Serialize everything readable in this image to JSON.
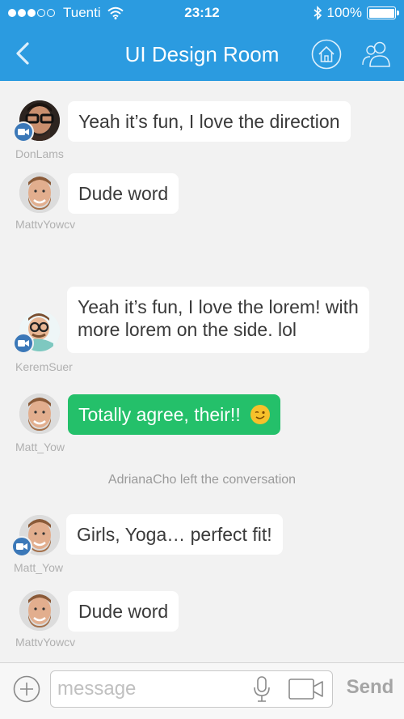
{
  "status_bar": {
    "carrier": "Tuenti",
    "time": "23:12",
    "battery": "100%",
    "signal_bars": 3,
    "signal_total": 5,
    "icons": [
      "wifi-icon",
      "bluetooth-icon",
      "battery-icon"
    ]
  },
  "header": {
    "title": "UI Design Room",
    "icons": [
      "back-chevron-icon",
      "home-icon",
      "people-icon"
    ]
  },
  "colors": {
    "header_bg": "#2b9be0",
    "sent_bubble": "#24c06a",
    "video_badge": "#3b78b8"
  },
  "messages": [
    {
      "user": "DonLams",
      "text": "Yeah it’s fun, I love the direction",
      "video_badge": true
    },
    {
      "user": "MattvYowcv",
      "text": "Dude word",
      "video_badge": false
    },
    {
      "user": "KeremSuer",
      "line1": "Yeah it’s fun, I love the lorem! with",
      "line2": "more lorem on the side. lol",
      "video_badge": true
    },
    {
      "user": "Matt_Yow",
      "text": "Totally agree, their!!",
      "emoji": "winking-face-emoji",
      "video_badge": false,
      "highlighted": true
    },
    {
      "user": "Matt_Yow",
      "text": "Girls, Yoga… perfect fit!",
      "video_badge": true
    },
    {
      "user": "MattvYowcv",
      "text": "Dude word",
      "video_badge": false
    }
  ],
  "system_note": "AdrianaCho left the conversation",
  "composer": {
    "placeholder": "message",
    "value": "",
    "send_label": "Send",
    "icons": [
      "add-circle-icon",
      "microphone-icon",
      "video-camera-icon"
    ]
  }
}
